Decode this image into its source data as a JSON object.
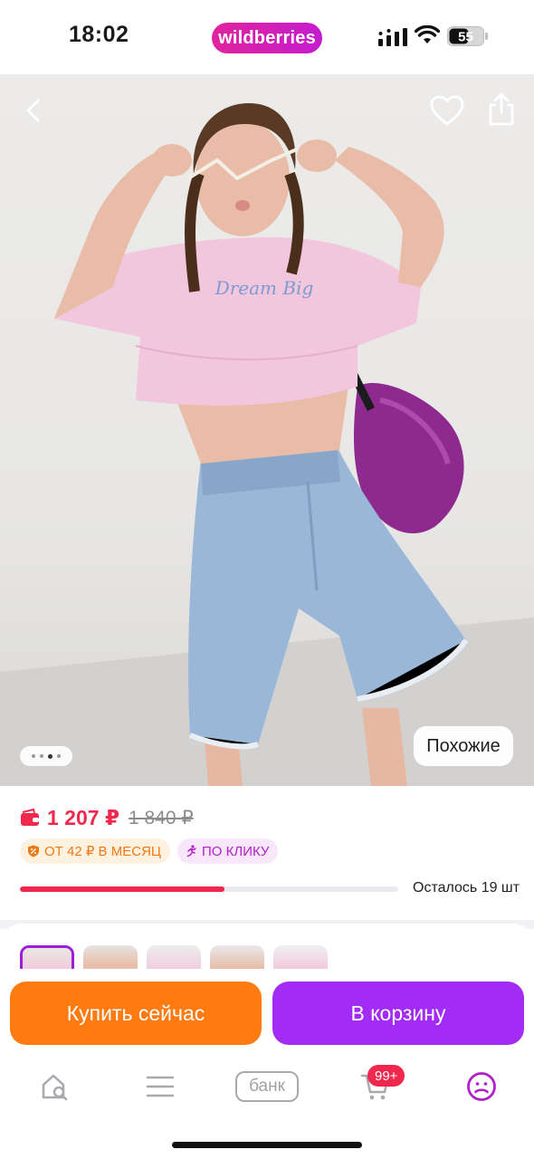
{
  "status_bar": {
    "time": "18:02",
    "brand": "wildberries",
    "battery": "55"
  },
  "gallery": {
    "similar_label": "Похожие",
    "dots_count": 4,
    "active_dot": 2,
    "shirt_print": "Dream Big"
  },
  "product": {
    "price_current": "1 207 ₽",
    "price_old": "1 840 ₽",
    "badge_installment": "ОТ 42 ₽ В МЕСЯЦ",
    "badge_click": "ПО КЛИКУ",
    "stock_label": "Осталось 19 шт",
    "stock_progress": 0.54
  },
  "actions": {
    "buy_now": "Купить сейчас",
    "add_to_cart": "В корзину"
  },
  "tabbar": {
    "bank_label": "банк",
    "cart_badge": "99+"
  },
  "colors": {
    "brand": "#cb11ab",
    "price": "#f0284d",
    "buy_button": "#ff7a0f",
    "cart_button": "#a32cf4",
    "installment_text": "#ec7a14",
    "click_text": "#b020c8"
  }
}
